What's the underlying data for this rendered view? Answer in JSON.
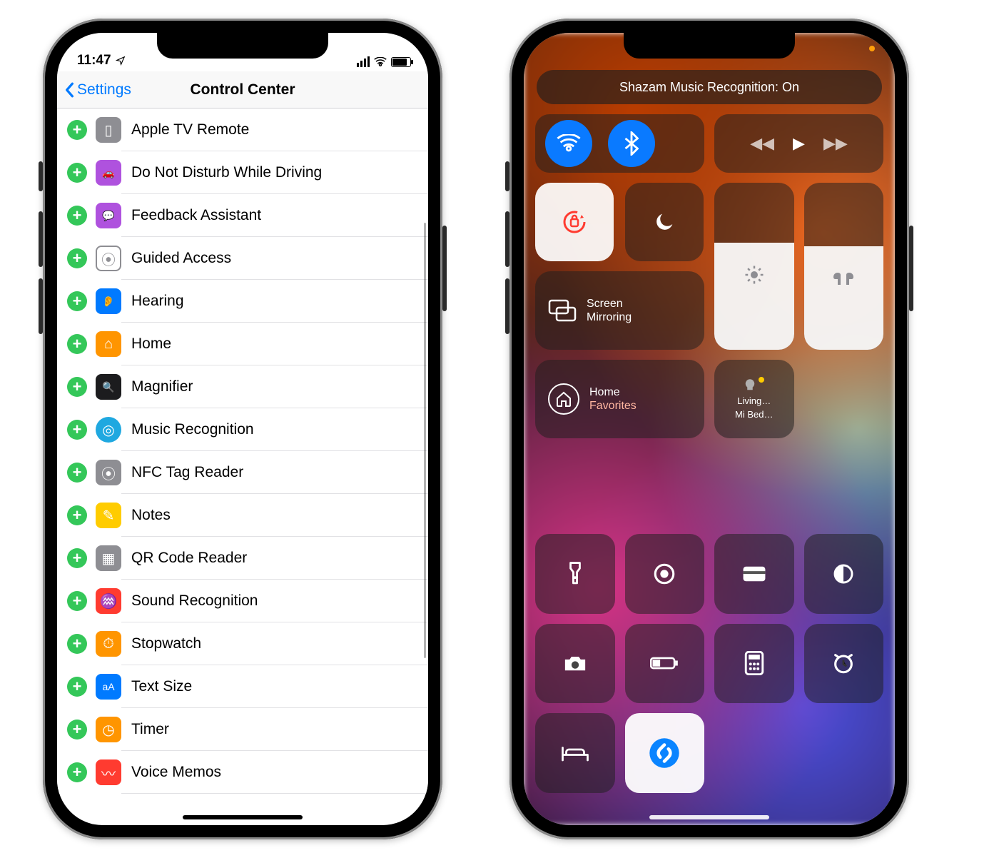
{
  "left_phone": {
    "status": {
      "time": "11:47"
    },
    "navbar": {
      "back_label": "Settings",
      "title": "Control Center"
    },
    "items": [
      {
        "label": "Apple TV Remote",
        "icon": "remote-icon",
        "icon_class": "ic-grey",
        "glyph": "▯"
      },
      {
        "label": "Do Not Disturb While Driving",
        "icon": "car-icon",
        "icon_class": "ic-purple",
        "glyph": "🚗"
      },
      {
        "label": "Feedback Assistant",
        "icon": "feedback-icon",
        "icon_class": "ic-purple",
        "glyph": "💬"
      },
      {
        "label": "Guided Access",
        "icon": "guided-icon",
        "icon_class": "ic-border",
        "glyph": "⦿"
      },
      {
        "label": "Hearing",
        "icon": "hearing-icon",
        "icon_class": "ic-blue",
        "glyph": "👂"
      },
      {
        "label": "Home",
        "icon": "home-icon",
        "icon_class": "ic-orange",
        "glyph": "⌂"
      },
      {
        "label": "Magnifier",
        "icon": "magnifier-icon",
        "icon_class": "ic-black",
        "glyph": "🔍"
      },
      {
        "label": "Music Recognition",
        "icon": "shazam-icon",
        "icon_class": "ic-cyan",
        "glyph": "◎"
      },
      {
        "label": "NFC Tag Reader",
        "icon": "nfc-icon",
        "icon_class": "ic-grey",
        "glyph": "⦿"
      },
      {
        "label": "Notes",
        "icon": "notes-icon",
        "icon_class": "ic-yellow",
        "glyph": "✎"
      },
      {
        "label": "QR Code Reader",
        "icon": "qr-icon",
        "icon_class": "ic-grey",
        "glyph": "▦"
      },
      {
        "label": "Sound Recognition",
        "icon": "sound-icon",
        "icon_class": "ic-red",
        "glyph": "♒"
      },
      {
        "label": "Stopwatch",
        "icon": "stopwatch-icon",
        "icon_class": "ic-orange",
        "glyph": "⏱"
      },
      {
        "label": "Text Size",
        "icon": "textsize-icon",
        "icon_class": "ic-blue",
        "glyph": "aA"
      },
      {
        "label": "Timer",
        "icon": "timer-icon",
        "icon_class": "ic-orange",
        "glyph": "◷"
      },
      {
        "label": "Voice Memos",
        "icon": "voicememos-icon",
        "icon_class": "ic-red",
        "glyph": "〰"
      }
    ]
  },
  "right_phone": {
    "toast": "Shazam Music Recognition: On",
    "screen_mirror": {
      "title": "Screen",
      "subtitle": "Mirroring"
    },
    "home_tile": {
      "title": "Home",
      "subtitle": "Favorites"
    },
    "scene_tile": {
      "line1": "Living…",
      "line2": "Mi Bed…"
    },
    "small_tiles": [
      {
        "name": "flashlight-tile",
        "glyph": "flashlight"
      },
      {
        "name": "screenrecord-tile",
        "glyph": "record"
      },
      {
        "name": "wallet-tile",
        "glyph": "wallet"
      },
      {
        "name": "darkmode-tile",
        "glyph": "darkmode"
      },
      {
        "name": "camera-tile",
        "glyph": "camera"
      },
      {
        "name": "lowpower-tile",
        "glyph": "battery"
      },
      {
        "name": "calculator-tile",
        "glyph": "calculator"
      },
      {
        "name": "alarm-tile",
        "glyph": "alarm"
      },
      {
        "name": "sleep-tile",
        "glyph": "bed"
      },
      {
        "name": "shazam-tile",
        "glyph": "shazam",
        "light": true
      }
    ]
  }
}
